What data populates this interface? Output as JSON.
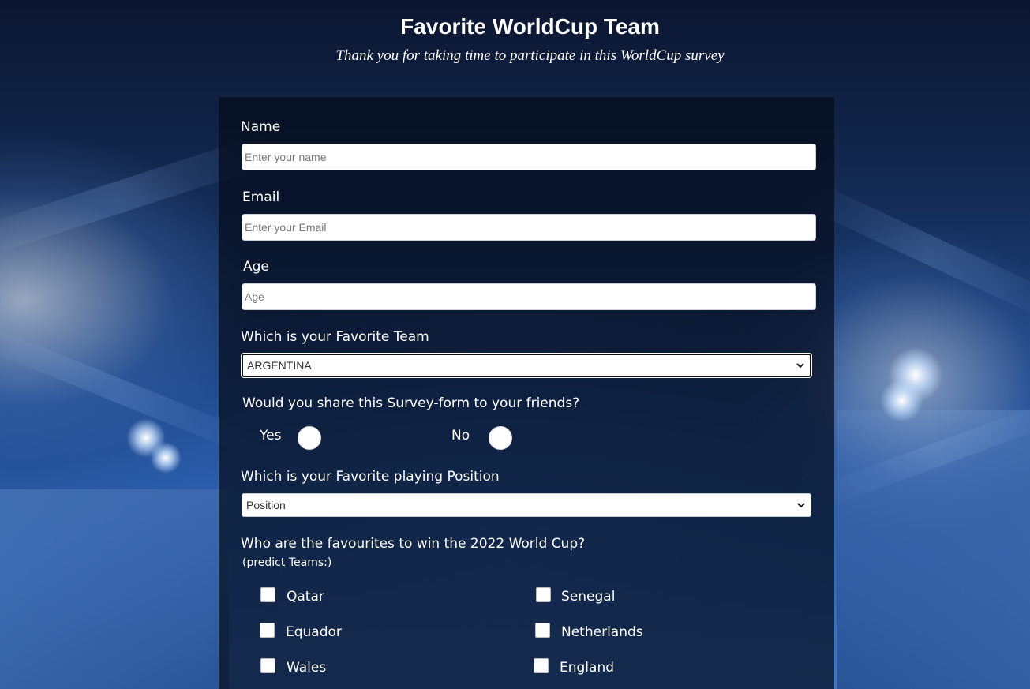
{
  "header": {
    "title": "Favorite WorldCup Team",
    "description": "Thank you for taking time to participate in this WorldCup survey"
  },
  "form": {
    "name": {
      "label": "Name",
      "placeholder": "Enter your name"
    },
    "email": {
      "label": "Email",
      "placeholder": "Enter your Email"
    },
    "age": {
      "label": "Age",
      "placeholder": "Age"
    },
    "team": {
      "label": "Which is your Favorite Team",
      "selected": "ARGENTINA"
    },
    "share": {
      "label": "Would you share this Survey-form to your friends?",
      "options": [
        {
          "label": "Yes",
          "checked": false
        },
        {
          "label": "No",
          "checked": false
        }
      ]
    },
    "position": {
      "label": "Which is your Favorite playing Position",
      "selected": "Position"
    },
    "favourites": {
      "label": "Who are the favourites to win the 2022 World Cup?",
      "sublabel": "(predict Teams:)",
      "teams": [
        {
          "label": "Qatar",
          "checked": false
        },
        {
          "label": "Senegal",
          "checked": false
        },
        {
          "label": "Equador",
          "checked": false
        },
        {
          "label": "Netherlands",
          "checked": false
        },
        {
          "label": "Wales",
          "checked": false
        },
        {
          "label": "England",
          "checked": false
        }
      ]
    }
  },
  "icons": {
    "select_arrow": "chevron-down-icon"
  }
}
